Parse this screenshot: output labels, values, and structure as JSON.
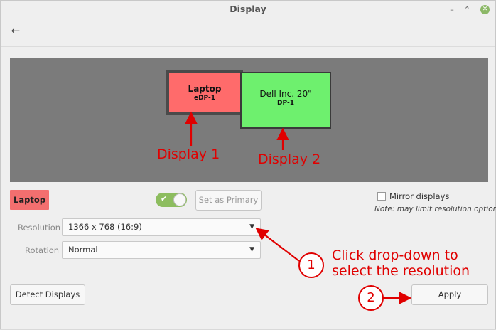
{
  "window": {
    "title": "Display",
    "minimize": "–",
    "maximize": "⌃",
    "close": "✕"
  },
  "toolbar": {
    "back": "←"
  },
  "monitors": [
    {
      "name": "Laptop",
      "port": "eDP-1",
      "color": "#ff6b6b"
    },
    {
      "name": "Dell Inc. 20\"",
      "port": "DP-1",
      "color": "#6ef06e"
    }
  ],
  "annotations": {
    "display1": "Display 1",
    "display2": "Display 2",
    "step1_number": "1",
    "step1_text_line1": "Click drop-down to",
    "step1_text_line2": "select the resolution",
    "step2_number": "2",
    "color": "#e00000"
  },
  "selected_monitor": {
    "label": "Laptop"
  },
  "toggle": {
    "check": "✔",
    "state": "on"
  },
  "buttons": {
    "set_primary": "Set as Primary",
    "detect": "Detect Displays",
    "apply": "Apply"
  },
  "mirror": {
    "label": "Mirror displays",
    "note": "Note: may limit resolution options"
  },
  "settings": {
    "resolution_label": "Resolution",
    "resolution_value": "1366 x 768 (16:9)",
    "rotation_label": "Rotation",
    "rotation_value": "Normal"
  }
}
